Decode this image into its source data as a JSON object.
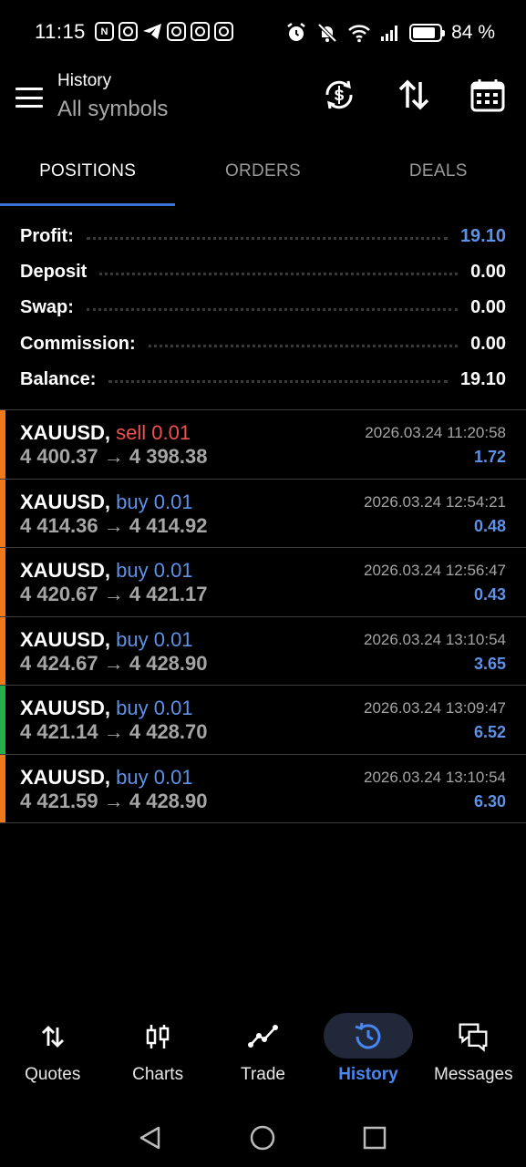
{
  "status_bar": {
    "time": "11:15",
    "battery_pct": "84 %",
    "battery_level": 0.84,
    "left_icons": [
      "n-notification-icon",
      "instagram-icon",
      "telegram-icon",
      "instagram-icon",
      "instagram-icon",
      "instagram-icon"
    ],
    "right_icons": [
      "alarm-icon",
      "mute-icon",
      "wifi-icon",
      "signal-icon",
      "battery-icon"
    ]
  },
  "app_bar": {
    "title": "History",
    "subtitle": "All symbols",
    "icons": [
      "currency-sync-icon",
      "sort-icon",
      "calendar-icon"
    ]
  },
  "tabs": [
    {
      "label": "POSITIONS",
      "active": true
    },
    {
      "label": "ORDERS",
      "active": false
    },
    {
      "label": "DEALS",
      "active": false
    }
  ],
  "summary": {
    "profit": {
      "label": "Profit:",
      "value": "19.10"
    },
    "deposit": {
      "label": "Deposit",
      "value": "0.00"
    },
    "swap": {
      "label": "Swap:",
      "value": "0.00"
    },
    "commission": {
      "label": "Commission:",
      "value": "0.00"
    },
    "balance": {
      "label": "Balance:",
      "value": "19.10"
    }
  },
  "positions": [
    {
      "symbol": "XAUUSD,",
      "side": "sell 0.01",
      "type": "sell",
      "prices": "4 400.37 → 4 398.38",
      "time": "2026.03.24 11:20:58",
      "profit": "1.72",
      "bar_color": "#f07a1a"
    },
    {
      "symbol": "XAUUSD,",
      "side": "buy 0.01",
      "type": "buy",
      "prices": "4 414.36 → 4 414.92",
      "time": "2026.03.24 12:54:21",
      "profit": "0.48",
      "bar_color": "#f07a1a"
    },
    {
      "symbol": "XAUUSD,",
      "side": "buy 0.01",
      "type": "buy",
      "prices": "4 420.67 → 4 421.17",
      "time": "2026.03.24 12:56:47",
      "profit": "0.43",
      "bar_color": "#f07a1a"
    },
    {
      "symbol": "XAUUSD,",
      "side": "buy 0.01",
      "type": "buy",
      "prices": "4 424.67 → 4 428.90",
      "time": "2026.03.24 13:10:54",
      "profit": "3.65",
      "bar_color": "#f07a1a"
    },
    {
      "symbol": "XAUUSD,",
      "side": "buy 0.01",
      "type": "buy",
      "prices": "4 421.14 → 4 428.70",
      "time": "2026.03.24 13:09:47",
      "profit": "6.52",
      "bar_color": "#25b04a"
    },
    {
      "symbol": "XAUUSD,",
      "side": "buy 0.01",
      "type": "buy",
      "prices": "4 421.59 → 4 428.90",
      "time": "2026.03.24 13:10:54",
      "profit": "6.30",
      "bar_color": "#f07a1a"
    }
  ],
  "bottom_nav": [
    {
      "label": "Quotes",
      "icon": "quotes-arrows-icon",
      "active": false
    },
    {
      "label": "Charts",
      "icon": "candlestick-icon",
      "active": false
    },
    {
      "label": "Trade",
      "icon": "trade-line-icon",
      "active": false
    },
    {
      "label": "History",
      "icon": "history-clock-icon",
      "active": true
    },
    {
      "label": "Messages",
      "icon": "messages-icon",
      "active": false
    }
  ],
  "system_nav": [
    "back-icon",
    "home-icon",
    "recents-icon"
  ],
  "colors": {
    "accent_blue": "#5e91e8",
    "sell_red": "#f0504f",
    "tab_underline": "#3d74d4",
    "nav_active": "#4a86f0"
  }
}
